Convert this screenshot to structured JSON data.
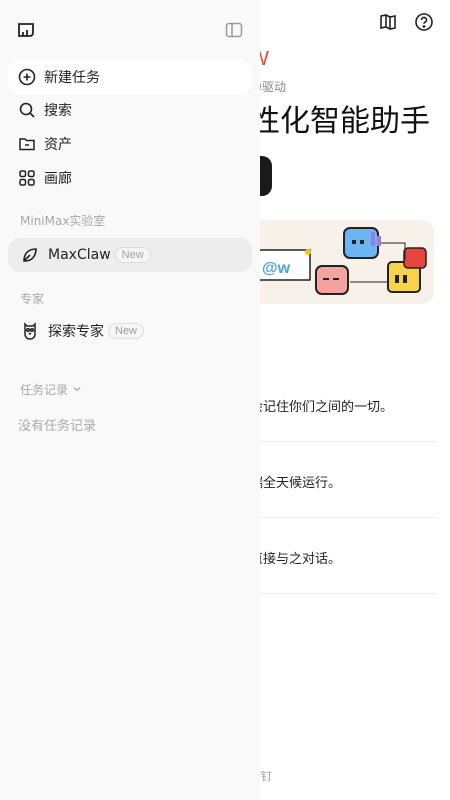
{
  "main": {
    "brand_fragment": "W",
    "subtitle_fragment": "力驱动",
    "headline_fragment": "性化智能助手",
    "features": [
      "会记住你们之间的一切。",
      "端全天候运行。",
      "直接与之对话。"
    ],
    "footer_fragment": "钉钉",
    "banner": {
      "handle": "@w"
    },
    "top_icons": [
      "book-icon",
      "help-icon"
    ]
  },
  "sidebar": {
    "nav": [
      {
        "label": "新建任务",
        "icon": "plus-circle-icon"
      },
      {
        "label": "搜索",
        "icon": "search-icon"
      },
      {
        "label": "资产",
        "icon": "folder-icon"
      },
      {
        "label": "画廊",
        "icon": "grid-icon"
      }
    ],
    "lab_section": {
      "title": "MiniMax实验室",
      "items": [
        {
          "label": "MaxClaw",
          "badge": "New",
          "icon": "leaf-icon"
        }
      ]
    },
    "expert_section": {
      "title": "专家",
      "items": [
        {
          "label": "探索专家",
          "badge": "New",
          "icon": "owl-icon"
        }
      ]
    },
    "records": {
      "title": "任务记录",
      "empty_text": "没有任务记录"
    }
  },
  "colors": {
    "accent_red": "#e8453c",
    "sidebar_bg": "#f9f9f9",
    "selected_bg": "#ededed"
  }
}
